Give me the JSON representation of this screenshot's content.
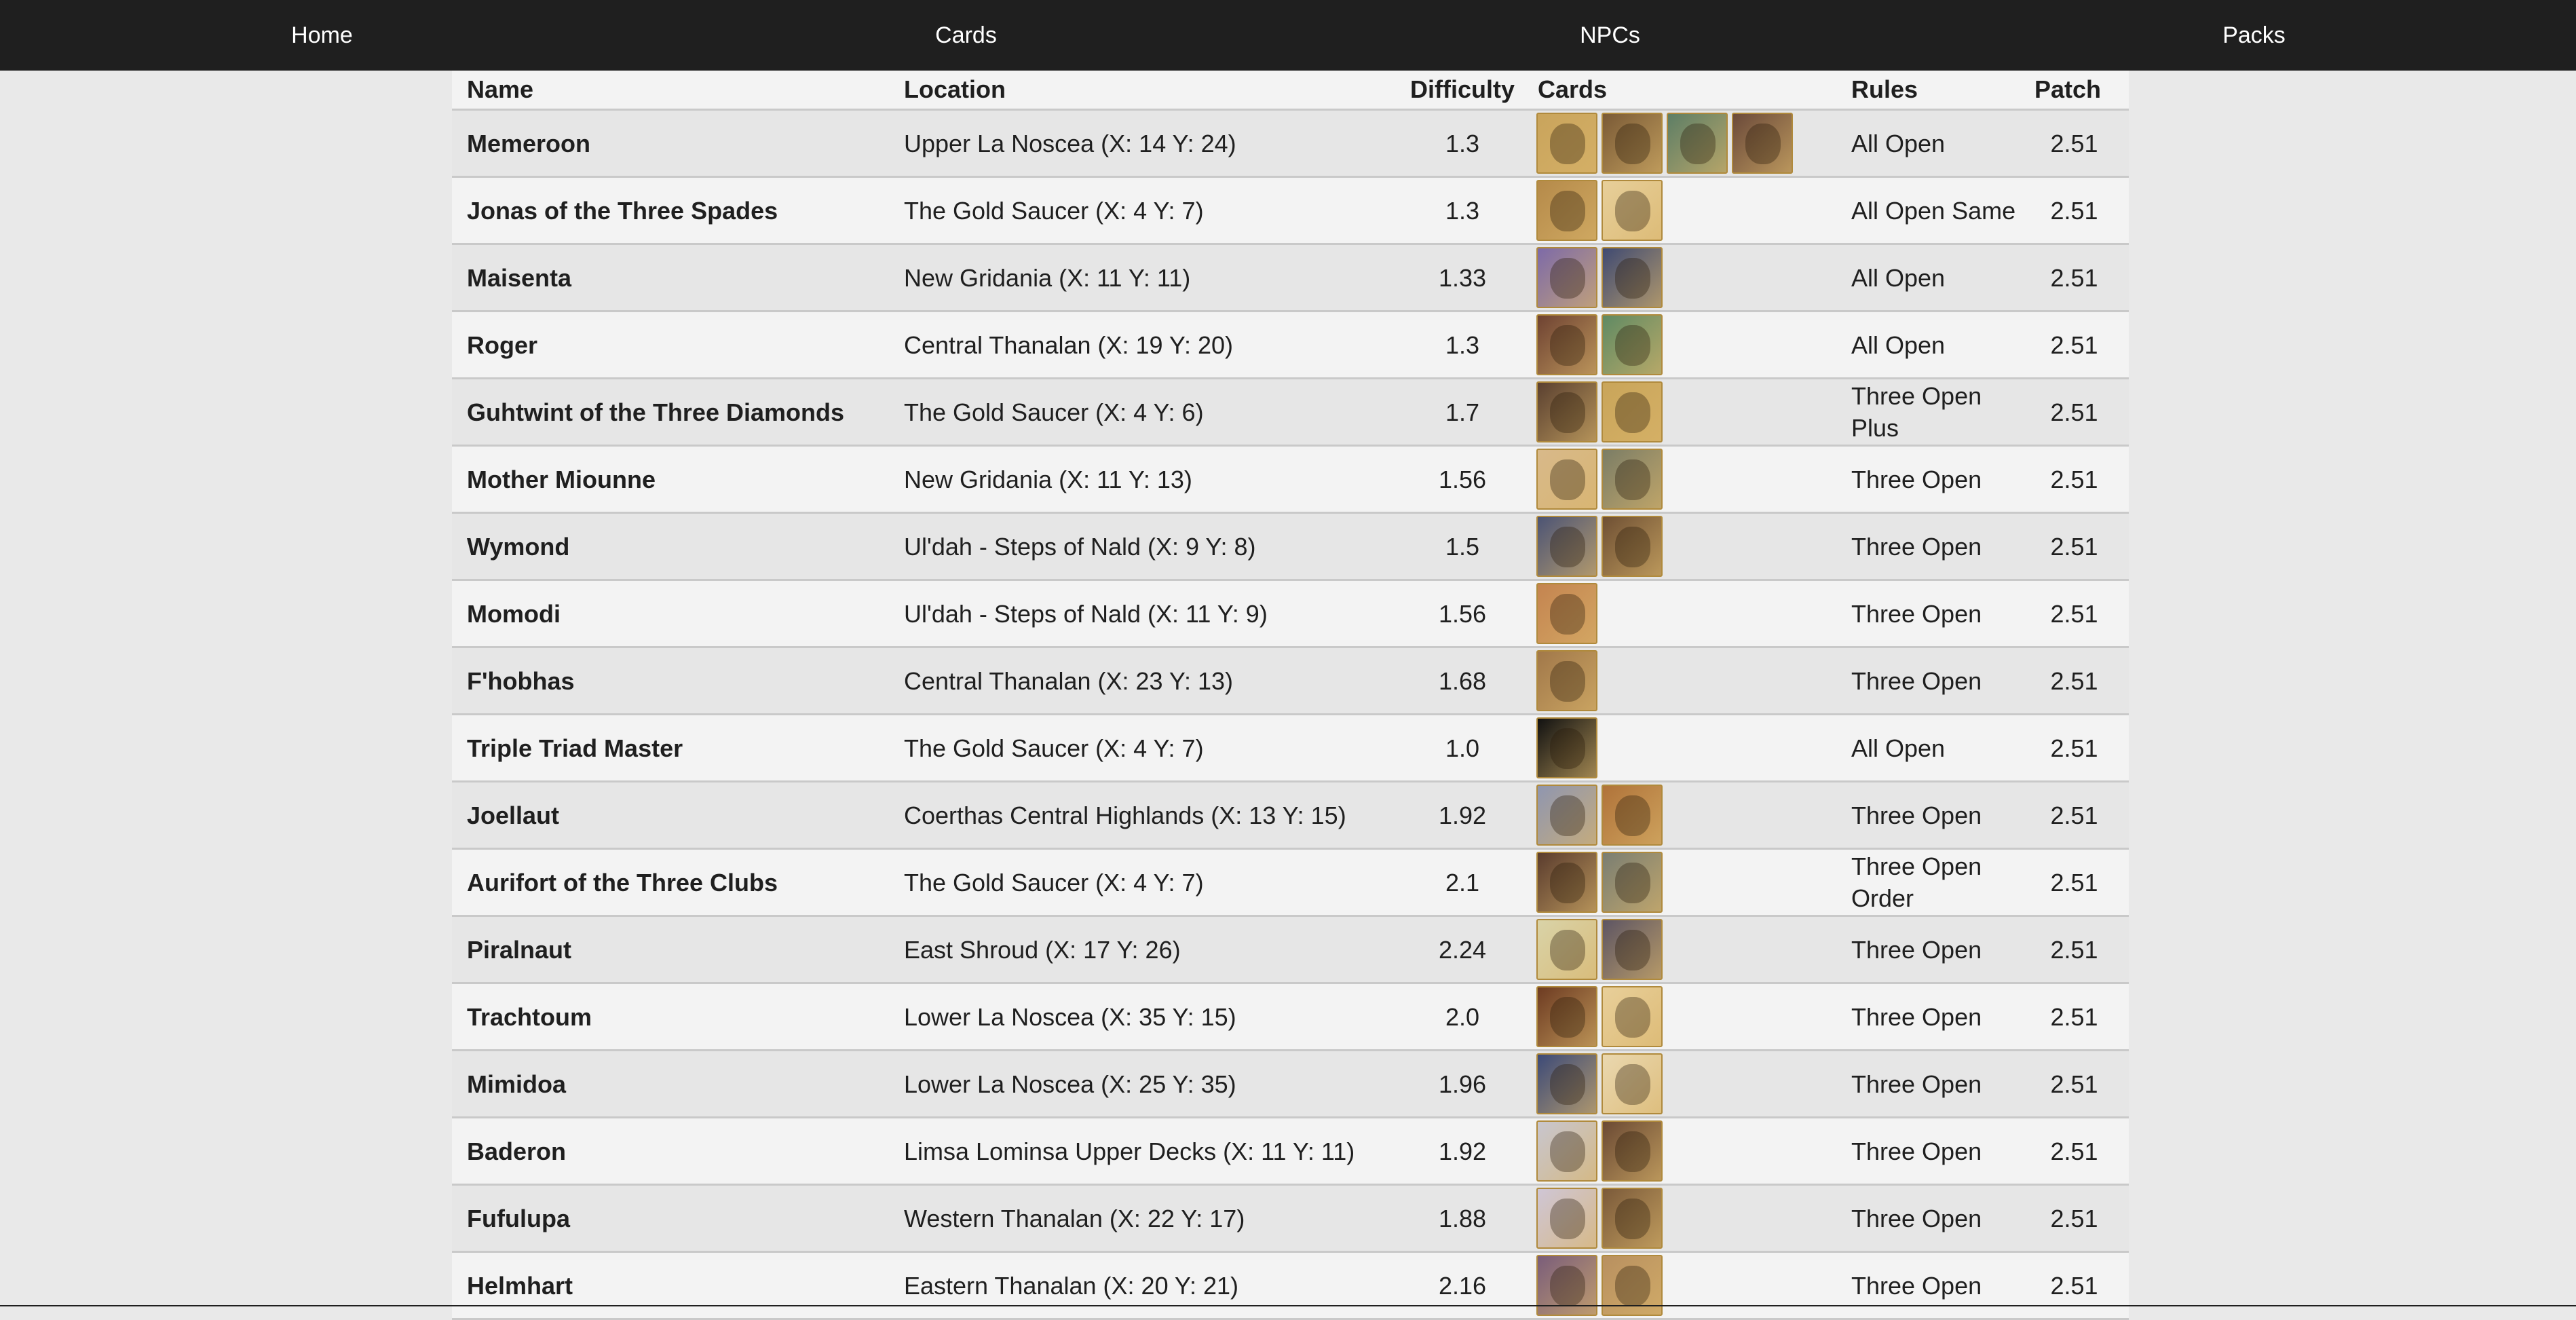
{
  "nav": {
    "items": [
      {
        "label": "Home"
      },
      {
        "label": "Cards"
      },
      {
        "label": "NPCs"
      },
      {
        "label": "Packs"
      }
    ]
  },
  "table": {
    "headers": {
      "name": "Name",
      "location": "Location",
      "difficulty": "Difficulty",
      "cards": "Cards",
      "rules": "Rules",
      "patch": "Patch"
    },
    "rows": [
      {
        "name": "Memeroon",
        "location": "Upper La Noscea (X: 14 Y: 24)",
        "difficulty": "1.3",
        "rules": "All Open",
        "patch": "2.51",
        "cards": [
          "#c9a45c",
          "#7a5a36",
          "#5d7e66",
          "#6b4a3a"
        ]
      },
      {
        "name": "Jonas of the Three Spades",
        "location": "The Gold Saucer (X: 4 Y: 7)",
        "difficulty": "1.3",
        "rules": "All Open Same",
        "patch": "2.51",
        "cards": [
          "#b58a4a",
          "#e7cf9a"
        ]
      },
      {
        "name": "Maisenta",
        "location": "New Gridania (X: 11 Y: 11)",
        "difficulty": "1.33",
        "rules": "All Open",
        "patch": "2.51",
        "cards": [
          "#7d6aa8",
          "#3f4a72"
        ]
      },
      {
        "name": "Roger",
        "location": "Central Thanalan (X: 19 Y: 20)",
        "difficulty": "1.3",
        "rules": "All Open",
        "patch": "2.51",
        "cards": [
          "#6e4232",
          "#5f8a63"
        ]
      },
      {
        "name": "Guhtwint of the Three Diamonds",
        "location": "The Gold Saucer (X: 4 Y: 6)",
        "difficulty": "1.7",
        "rules": "Three Open Plus",
        "patch": "2.51",
        "cards": [
          "#5a4030",
          "#c9a55a"
        ]
      },
      {
        "name": "Mother Miounne",
        "location": "New Gridania (X: 11 Y: 13)",
        "difficulty": "1.56",
        "rules": "Three Open",
        "patch": "2.51",
        "cards": [
          "#d8b98a",
          "#7b7d66"
        ]
      },
      {
        "name": "Wymond",
        "location": "Ul'dah - Steps of Nald (X: 9 Y: 8)",
        "difficulty": "1.5",
        "rules": "Three Open",
        "patch": "2.51",
        "cards": [
          "#4c5475",
          "#6f5034"
        ]
      },
      {
        "name": "Momodi",
        "location": "Ul'dah - Steps of Nald (X: 11 Y: 9)",
        "difficulty": "1.56",
        "rules": "Three Open",
        "patch": "2.51",
        "cards": [
          "#c48450"
        ]
      },
      {
        "name": "F'hobhas",
        "location": "Central Thanalan (X: 23 Y: 13)",
        "difficulty": "1.68",
        "rules": "Three Open",
        "patch": "2.51",
        "cards": [
          "#a1784a"
        ]
      },
      {
        "name": "Triple Triad Master",
        "location": "The Gold Saucer (X: 4 Y: 7)",
        "difficulty": "1.0",
        "rules": "All Open",
        "patch": "2.51",
        "cards": [
          "#111111"
        ]
      },
      {
        "name": "Joellaut",
        "location": "Coerthas Central Highlands (X: 13 Y: 15)",
        "difficulty": "1.92",
        "rules": "Three Open",
        "patch": "2.51",
        "cards": [
          "#8f96b0",
          "#b0733a"
        ]
      },
      {
        "name": "Aurifort of the Three Clubs",
        "location": "The Gold Saucer (X: 4 Y: 7)",
        "difficulty": "2.1",
        "rules": "Three Open Order",
        "patch": "2.51",
        "cards": [
          "#5a3c2e",
          "#7a7e72"
        ]
      },
      {
        "name": "Piralnaut",
        "location": "East Shroud (X: 17 Y: 26)",
        "difficulty": "2.24",
        "rules": "Three Open",
        "patch": "2.51",
        "cards": [
          "#d9d3a8",
          "#5d5563"
        ]
      },
      {
        "name": "Trachtoum",
        "location": "Lower La Noscea (X: 35 Y: 15)",
        "difficulty": "2.0",
        "rules": "Three Open",
        "patch": "2.51",
        "cards": [
          "#6d3b22",
          "#e8cf9a"
        ]
      },
      {
        "name": "Mimidoa",
        "location": "Lower La Noscea (X: 25 Y: 35)",
        "difficulty": "1.96",
        "rules": "Three Open",
        "patch": "2.51",
        "cards": [
          "#3c4a78",
          "#ead8b0"
        ]
      },
      {
        "name": "Baderon",
        "location": "Limsa Lominsa Upper Decks (X: 11 Y: 11)",
        "difficulty": "1.92",
        "rules": "Three Open",
        "patch": "2.51",
        "cards": [
          "#c8c6cf",
          "#6b4a34"
        ]
      },
      {
        "name": "Fufulupa",
        "location": "Western Thanalan (X: 22 Y: 17)",
        "difficulty": "1.88",
        "rules": "Three Open",
        "patch": "2.51",
        "cards": [
          "#cfc6d6",
          "#7b5a3a"
        ]
      },
      {
        "name": "Helmhart",
        "location": "Eastern Thanalan (X: 20 Y: 21)",
        "difficulty": "2.16",
        "rules": "Three Open",
        "patch": "2.51",
        "cards": [
          "#7a5d7a",
          "#b89060"
        ]
      }
    ]
  }
}
